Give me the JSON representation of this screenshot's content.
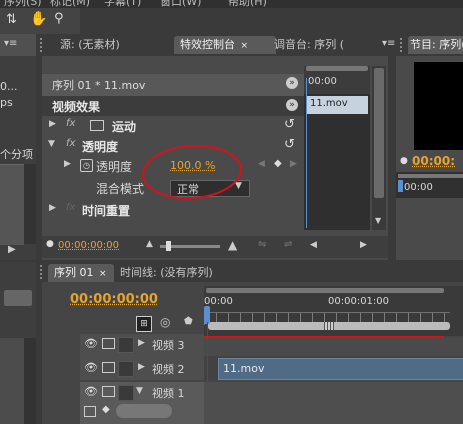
{
  "menubar": {
    "items": [
      "序列(S)",
      "标记(M)",
      "字幕(T)",
      "窗口(W)",
      "帮助(H)"
    ]
  },
  "left": {
    "text1": "0...",
    "text2": "ps",
    "text3": "个分项"
  },
  "tabs_top": {
    "source": "源: (无素材)",
    "effects": "特效控制台",
    "mixer": "调音台: 序列 (",
    "program": "节目: 序列("
  },
  "effects": {
    "clip_path": "序列 01 * 11.mov",
    "section_title": "视频效果",
    "motion": "运动",
    "opacity": "透明度",
    "opacity_param": "透明度",
    "opacity_value": "100.0 %",
    "blend_label": "混合模式",
    "blend_value": "正常",
    "time_remap": "时间重置",
    "timecode": "00:00:00:00",
    "mini_time": "00:00",
    "clip_name": "11.mov",
    "fx_label": "fx"
  },
  "program": {
    "timecode": "00:00:",
    "ruler_time": "00:00"
  },
  "timeline": {
    "tab_seq": "序列 01",
    "tab_close": "×",
    "tab_timeline": "时间线: (没有序列)",
    "timecode": "00:00:00:00",
    "ruler_start": "00:00",
    "ruler_mid": "00:00:01:00",
    "tracks": [
      {
        "name": "视频 3"
      },
      {
        "name": "视频 2"
      },
      {
        "name": "视频 1"
      }
    ],
    "clip": "11.mov"
  },
  "colors": {
    "accent": "#e8a32a",
    "annotation": "#d8101a",
    "clip": "#4f6b86"
  }
}
